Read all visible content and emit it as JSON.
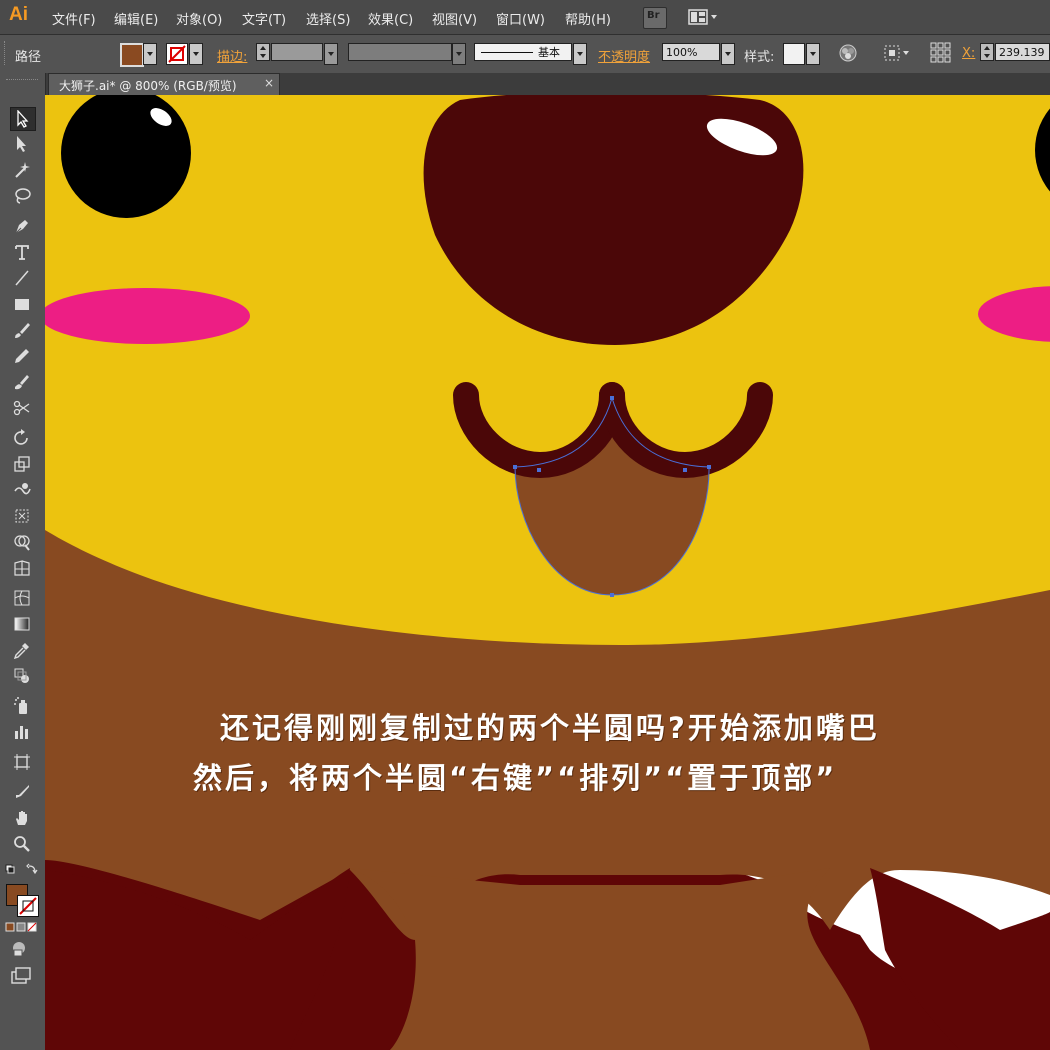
{
  "app": {
    "logo": "Ai",
    "menus": [
      "文件(F)",
      "编辑(E)",
      "对象(O)",
      "文字(T)",
      "选择(S)",
      "效果(C)",
      "视图(V)",
      "窗口(W)",
      "帮助(H)"
    ],
    "bridge_label": "Br"
  },
  "control_bar": {
    "selection_type": "路径",
    "fill_color": "#8a4a21",
    "stroke_label": "描边:",
    "stroke_style_label": "基本",
    "opacity_label": "不透明度",
    "opacity_value": "100%",
    "style_label": "样式:",
    "x_label": "X:",
    "x_value": "239.139"
  },
  "document_tab": {
    "title": "大狮子.ai* @ 800% (RGB/预览)",
    "close": "×"
  },
  "tools": [
    "selection-tool",
    "direct-selection-tool",
    "magic-wand-tool",
    "lasso-tool",
    "pen-tool",
    "type-tool",
    "line-tool",
    "rectangle-tool",
    "paintbrush-tool",
    "pencil-tool",
    "blob-brush-tool",
    "scissors-tool",
    "rotate-tool",
    "scale-tool",
    "warp-tool",
    "free-transform-tool",
    "shape-builder-tool",
    "graph-tool",
    "mesh-tool",
    "gradient-tool",
    "eyedropper-tool",
    "blend-tool",
    "symbol-sprayer-tool",
    "column-graph-tool",
    "artboard-tool",
    "slice-tool",
    "hand-tool",
    "zoom-tool"
  ],
  "canvas": {
    "colors": {
      "face": "#ecc30f",
      "mane": "#884a21",
      "mane_dark": "#5f0606",
      "nose": "#4b0708",
      "blush": "#ed1e84",
      "eye": "#000000",
      "tongue": "#884a21",
      "selection": "#4a6fd8"
    },
    "caption_line1": "还记得刚刚复制过的两个半圆吗?开始添加嘴巴",
    "caption_line2": "然后，将两个半圆“右键”“排列”“置于顶部”"
  }
}
